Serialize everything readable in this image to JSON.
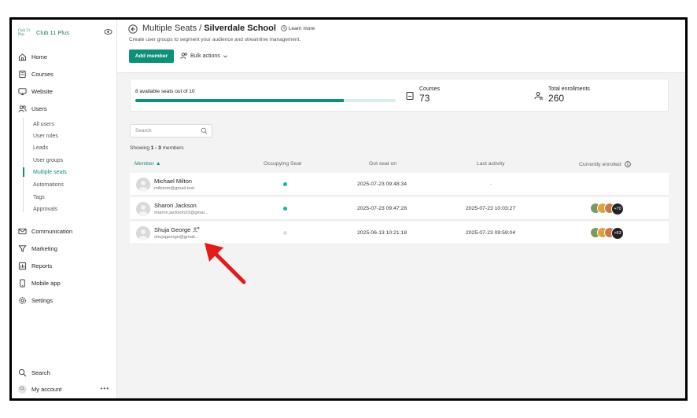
{
  "brand": {
    "logo_text": "Club 11 Plus",
    "name": "Club 11 Plus"
  },
  "nav": {
    "home": "Home",
    "courses": "Courses",
    "website": "Website",
    "users": "Users",
    "users_sub": [
      "All users",
      "User roles",
      "Leads",
      "User groups",
      "Multiple seats",
      "Automations",
      "Tags",
      "Approvals"
    ],
    "communication": "Communication",
    "marketing": "Marketing",
    "reports": "Reports",
    "mobile_app": "Mobile app",
    "settings": "Settings",
    "search": "Search",
    "account_initials": "CL",
    "my_account": "My account",
    "account_menu": "•••"
  },
  "header": {
    "title_prefix": "Multiple Seats /",
    "title_name": "Silverdale School",
    "learn_more": "Learn more",
    "subtitle": "Create user groups to segment your audience and streamline management.",
    "add_member": "Add member",
    "bulk_actions": "Bulk actions"
  },
  "stats": {
    "seats_label": "8 available seats out of 10",
    "seats_fraction": 0.8,
    "courses_label": "Courses",
    "courses_value": "73",
    "enrollments_label": "Total enrollments",
    "enrollments_value": "260"
  },
  "table": {
    "search_placeholder": "Search",
    "showing_prefix": "Showing",
    "showing_range": "1 - 3",
    "showing_suffix": "members",
    "columns": {
      "member": "Member ▲",
      "occupying": "Occupying Seat",
      "got_seat": "Got seat on",
      "last_activity": "Last activity",
      "enrolled": "Currently enrolled"
    },
    "rows": [
      {
        "name": "Michael Milton",
        "email": "miltonm@gmail.test",
        "occupying": true,
        "got_seat": "2025-07-23 09:48:34",
        "last_activity": "-",
        "enrolled_more": ""
      },
      {
        "name": "Sharon Jackson",
        "email": "sharon.jackson33@gmai...",
        "occupying": true,
        "got_seat": "2025-07-23 09:47:28",
        "last_activity": "2025-07-23 10:03:27",
        "enrolled_more": "+70"
      },
      {
        "name": "Shuja George",
        "email": "shujageorge@gmail...",
        "occupying": false,
        "got_seat": "2025-06-13 10:21:18",
        "last_activity": "2025-07-23 09:59:04",
        "enrolled_more": "+63"
      }
    ]
  },
  "colors": {
    "accent": "#0e8f78",
    "seat_on": "#1bb4a4",
    "arrow": "#e31b1b"
  }
}
